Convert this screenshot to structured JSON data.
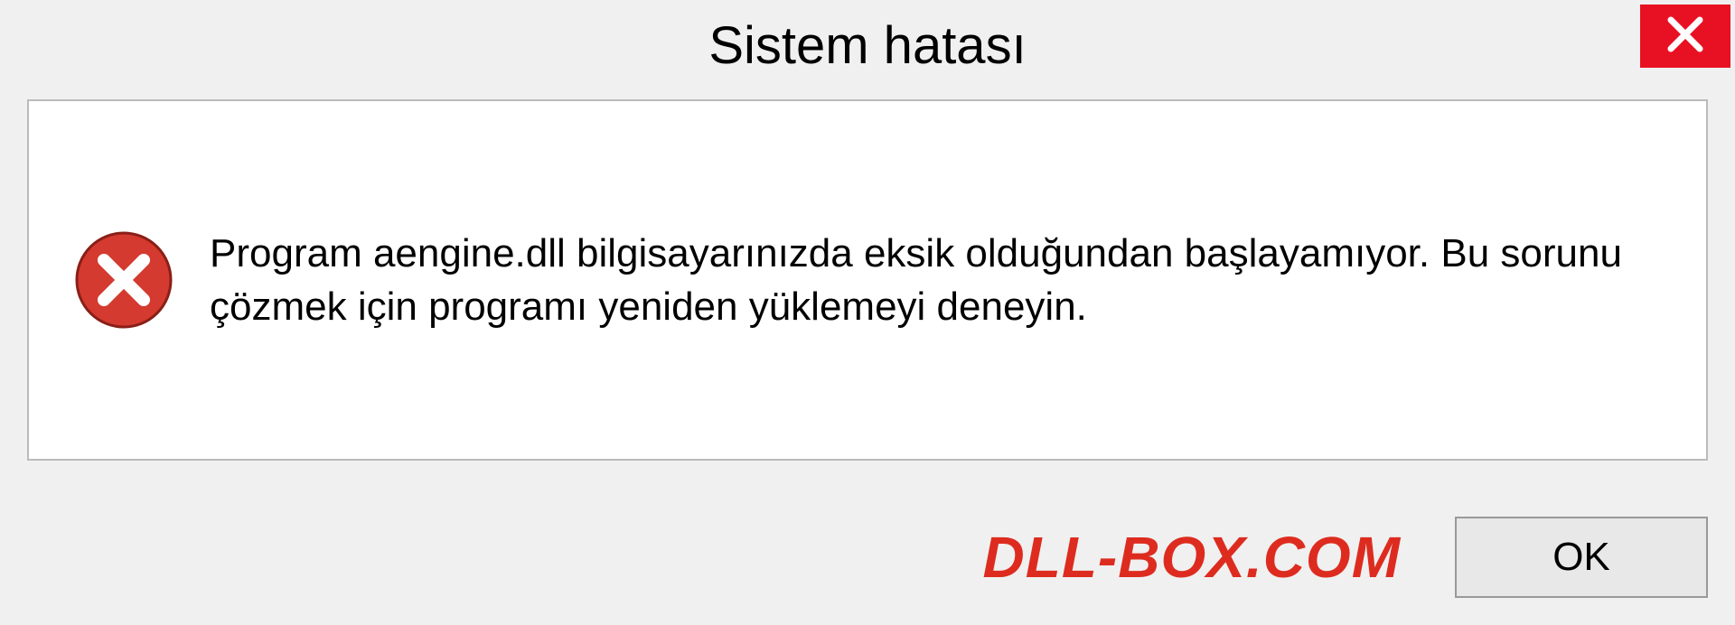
{
  "dialog": {
    "title": "Sistem hatası",
    "message": "Program aengine.dll bilgisayarınızda eksik olduğundan başlayamıyor. Bu sorunu çözmek için programı yeniden yüklemeyi deneyin.",
    "ok_label": "OK"
  },
  "watermark": "DLL-BOX.COM",
  "colors": {
    "close_bg": "#e81123",
    "error_icon": "#d43a2f",
    "watermark": "#dd2c1f"
  }
}
